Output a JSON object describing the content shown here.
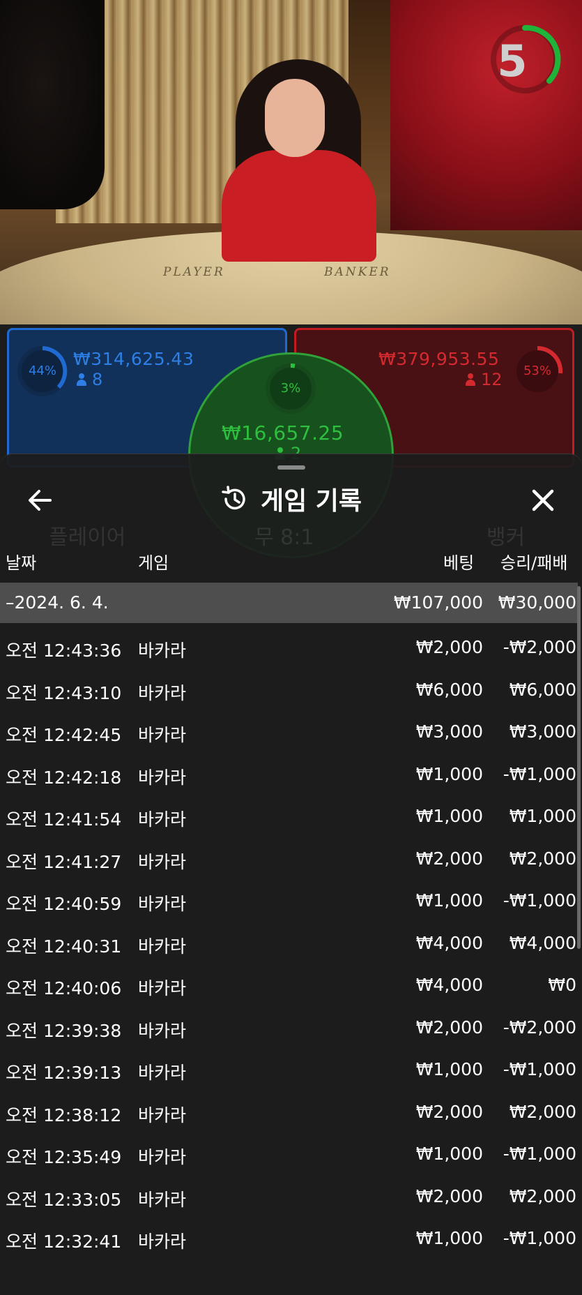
{
  "scene": {
    "timer_value": "5",
    "felt_player": "PLAYER",
    "felt_banker": "BANKER"
  },
  "bets": {
    "player": {
      "percent": "44%",
      "amount": "₩314,625.43",
      "players": "8"
    },
    "banker": {
      "percent": "53%",
      "amount": "₩379,953.55",
      "players": "12"
    },
    "tie": {
      "percent": "3%",
      "amount": "₩16,657.25",
      "players": "2"
    },
    "bg_player_label": "플레이어",
    "bg_tie_label": "무 8:1",
    "bg_banker_label": "뱅커"
  },
  "history": {
    "title": "게임 기록",
    "columns": {
      "date": "날짜",
      "game": "게임",
      "bet": "베팅",
      "result": "승리/패배"
    },
    "date_group": {
      "label": "–2024. 6. 4.",
      "bet_total": "₩107,000",
      "result_total": "₩30,000"
    },
    "rows": [
      {
        "time": "오전 12:43:36",
        "game": "바카라",
        "bet": "₩2,000",
        "result": "-₩2,000"
      },
      {
        "time": "오전 12:43:10",
        "game": "바카라",
        "bet": "₩6,000",
        "result": "₩6,000"
      },
      {
        "time": "오전 12:42:45",
        "game": "바카라",
        "bet": "₩3,000",
        "result": "₩3,000"
      },
      {
        "time": "오전 12:42:18",
        "game": "바카라",
        "bet": "₩1,000",
        "result": "-₩1,000"
      },
      {
        "time": "오전 12:41:54",
        "game": "바카라",
        "bet": "₩1,000",
        "result": "₩1,000"
      },
      {
        "time": "오전 12:41:27",
        "game": "바카라",
        "bet": "₩2,000",
        "result": "₩2,000"
      },
      {
        "time": "오전 12:40:59",
        "game": "바카라",
        "bet": "₩1,000",
        "result": "-₩1,000"
      },
      {
        "time": "오전 12:40:31",
        "game": "바카라",
        "bet": "₩4,000",
        "result": "₩4,000"
      },
      {
        "time": "오전 12:40:06",
        "game": "바카라",
        "bet": "₩4,000",
        "result": "₩0"
      },
      {
        "time": "오전 12:39:38",
        "game": "바카라",
        "bet": "₩2,000",
        "result": "-₩2,000"
      },
      {
        "time": "오전 12:39:13",
        "game": "바카라",
        "bet": "₩1,000",
        "result": "-₩1,000"
      },
      {
        "time": "오전 12:38:12",
        "game": "바카라",
        "bet": "₩2,000",
        "result": "₩2,000"
      },
      {
        "time": "오전 12:35:49",
        "game": "바카라",
        "bet": "₩1,000",
        "result": "-₩1,000"
      },
      {
        "time": "오전 12:33:05",
        "game": "바카라",
        "bet": "₩2,000",
        "result": "₩2,000"
      },
      {
        "time": "오전 12:32:41",
        "game": "바카라",
        "bet": "₩1,000",
        "result": "-₩1,000"
      }
    ]
  },
  "colors": {
    "player": "#1f6bd1",
    "banker": "#d42a2f",
    "tie": "#2fbf3f",
    "timer": "#1fb33a"
  }
}
